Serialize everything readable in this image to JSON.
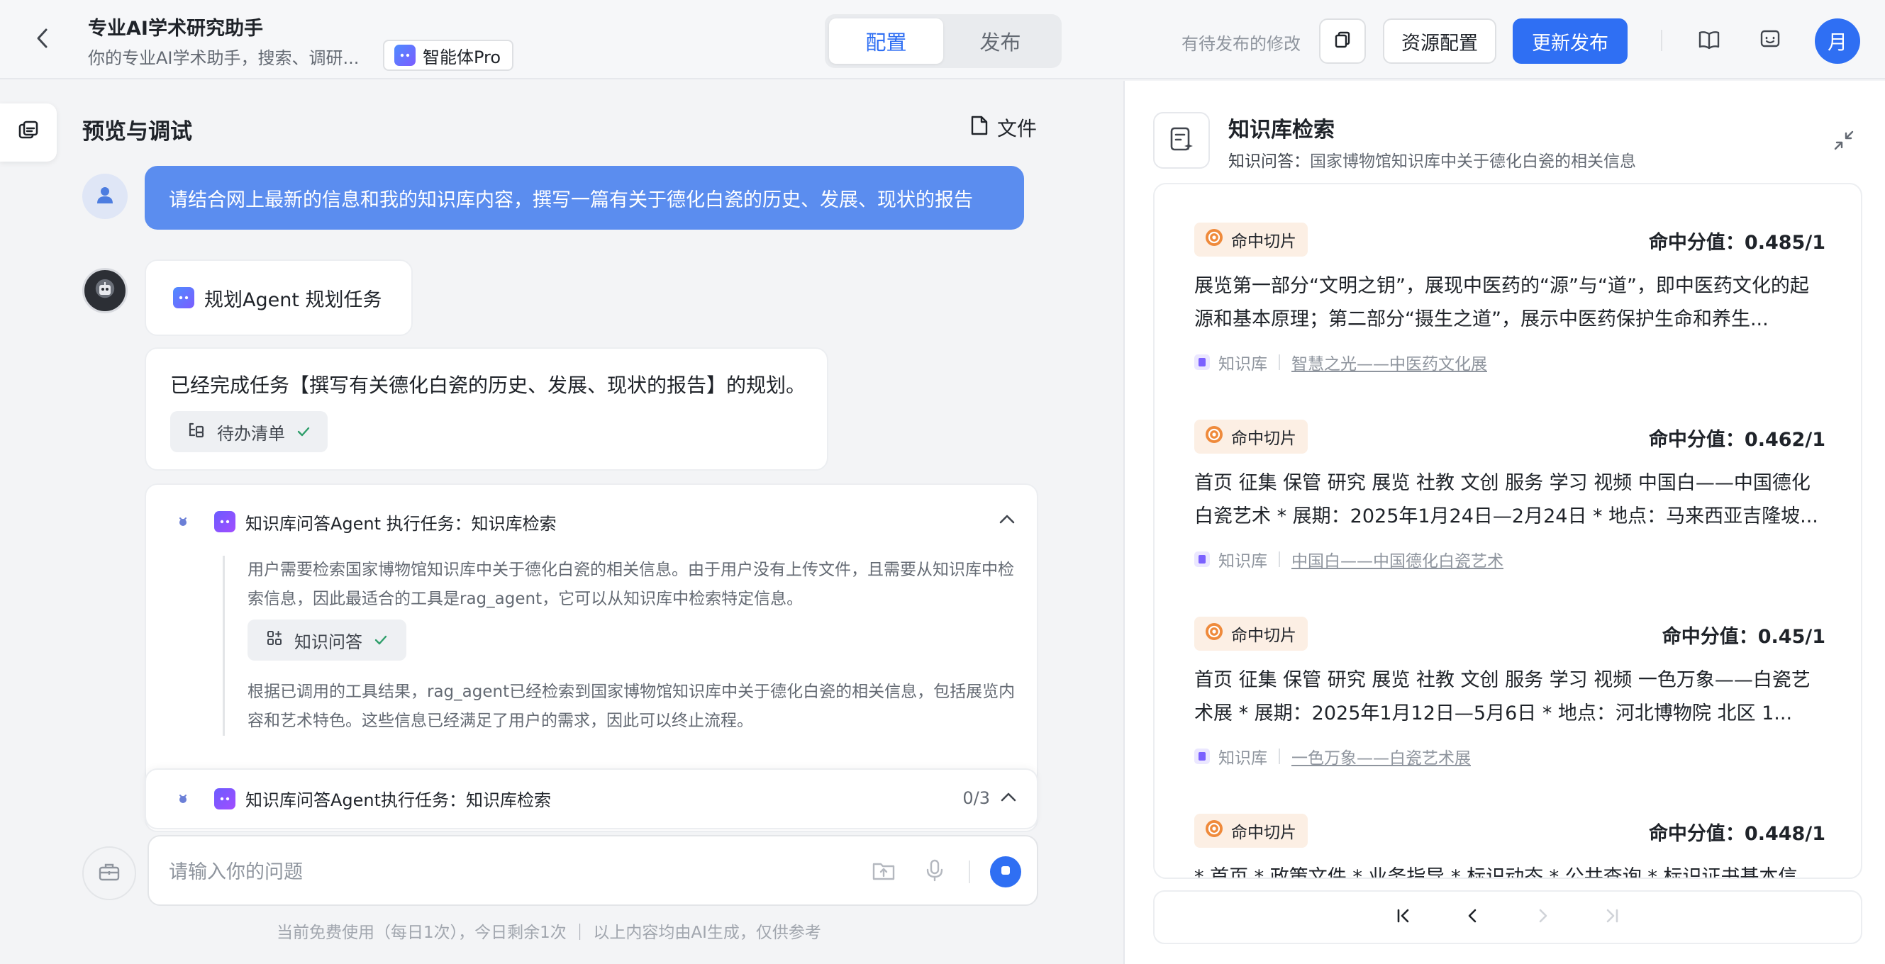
{
  "header": {
    "title": "专业AI学术研究助手",
    "subtitle": "你的专业AI学术助手，搜索、调研...",
    "model_label": "智能体Pro",
    "tabs": [
      {
        "label": "配置",
        "active": true
      },
      {
        "label": "发布",
        "active": false
      }
    ],
    "pending_text": "有待发布的修改",
    "resource_btn": "资源配置",
    "publish_btn": "更新发布",
    "user_avatar": "月",
    "accent_color": "#2f6ff3"
  },
  "preview": {
    "title": "预览与调试",
    "file_btn": "文件",
    "user_message": "请结合网上最新的信息和我的知识库内容，撰写一篇有关于德化白瓷的历史、发展、现状的报告",
    "plan_label": "规划Agent 规划任务",
    "plan_done_text": "已经完成任务【撰写有关德化白瓷的历史、发展、现状的报告】的规划。",
    "todo_label": "待办清单",
    "task": {
      "title": "知识库问答Agent 执行任务：知识库检索",
      "para1": "用户需要检索国家博物馆知识库中关于德化白瓷的相关信息。由于用户没有上传文件，且需要从知识库中检索信息，因此最适合的工具是rag_agent，它可以从知识库中检索特定信息。",
      "tool_chip": "知识问答",
      "para2": "根据已调用的工具结果，rag_agent已经检索到国家博物馆知识库中关于德化白瓷的相关信息，包括展览内容和艺术特色。这些信息已经满足了用户的需求，因此可以终止流程。"
    },
    "progress": {
      "title": "知识库问答Agent执行任务：知识库检索",
      "count": "0/3"
    },
    "input_placeholder": "请输入你的问题",
    "footer_note": "当前免费使用（每日1次），今日剩余1次 ｜ 以上内容均由AI生成，仅供参考"
  },
  "knowledge": {
    "title": "知识库检索",
    "subtitle_label": "知识问答：",
    "subtitle_value": "国家博物馆知识库中关于德化白瓷的相关信息",
    "results": [
      {
        "badge": "命中切片",
        "score": "命中分值：0.485/1",
        "text": "展览第一部分“文明之钥”，展现中医药的“源”与“道”，即中医药文化的起源和基本原理；第二部分“摄生之道”，展示中医药保护生命和养生...",
        "source_label": "知识库",
        "source_link": "智慧之光——中医药文化展"
      },
      {
        "badge": "命中切片",
        "score": "命中分值：0.462/1",
        "text": "首页 征集 保管 研究 展览 社教 文创 服务 学习 视频 中国白——中国德化白瓷艺术 * 展期：2025年1月24日—2月24日 * 地点：马来西亚吉隆坡...",
        "source_label": "知识库",
        "source_link": "中国白——中国德化白瓷艺术"
      },
      {
        "badge": "命中切片",
        "score": "命中分值：0.45/1",
        "text": "首页 征集 保管 研究 展览 社教 文创 服务 学习 视频 一色万象——白瓷艺术展 * 展期：2025年1月12日—5月6日 * 地点：河北博物院 北区 1...",
        "source_label": "知识库",
        "source_link": "一色万象——白瓷艺术展"
      },
      {
        "badge": "命中切片",
        "score": "命中分值：0.448/1",
        "text": "* 首页 * 政策文件 * 业务指导 * 标识动态 * 公共查询 * 标识证书基本信",
        "source_label": "",
        "source_link": ""
      }
    ]
  }
}
